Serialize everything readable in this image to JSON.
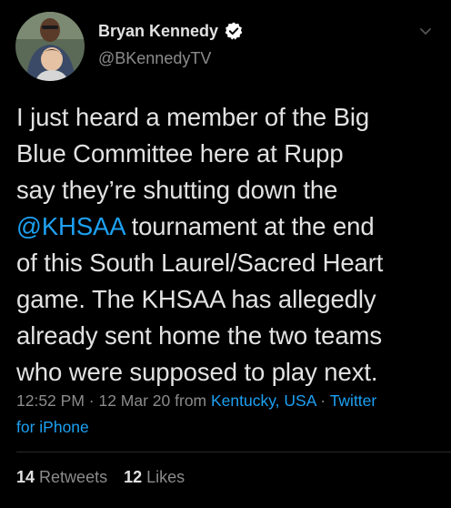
{
  "author": {
    "display_name": "Bryan Kennedy",
    "handle": "@BKennedyTV",
    "verified_icon": "verified-badge-icon",
    "avatar_icon": "profile-avatar"
  },
  "tweet": {
    "line1": "I just heard a member of the Big",
    "line2": "Blue Committee here at Rupp",
    "line3": "say they’re shutting down the",
    "mention": "@KHSAA",
    "line4_rest": " tournament at the end",
    "line5": "of this South Laurel/Sacred Heart",
    "line6": "game. The KHSAA has allegedly",
    "line7": "already sent home the two teams",
    "line8": "who were supposed to play next."
  },
  "meta": {
    "time": "12:52 PM",
    "separator1": " · ",
    "date": "12 Mar 20",
    "from_word": " from ",
    "location": "Kentucky, USA",
    "separator2": " · ",
    "source_part1": "Twitter",
    "source_part2": "for iPhone"
  },
  "stats": {
    "retweets_count": "14",
    "retweets_label": "Retweets",
    "likes_count": "12",
    "likes_label": "Likes"
  },
  "colors": {
    "background": "#000000",
    "link": "#1da1f2",
    "secondary": "#8b8b8b",
    "primary": "#e2e2e2"
  },
  "icons": {
    "caret": "chevron-down-icon",
    "verified": "verified-badge-icon"
  }
}
